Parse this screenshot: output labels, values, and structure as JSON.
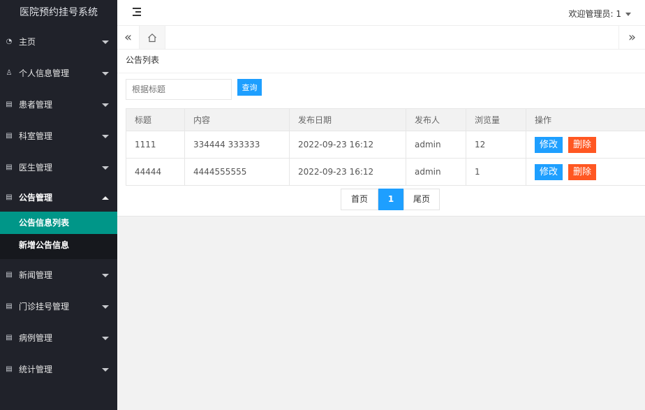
{
  "app_title": "医院预约挂号系统",
  "header": {
    "welcome": "欢迎管理员: 1"
  },
  "sidebar": {
    "items": [
      {
        "label": "主页",
        "icon": "dashboard-icon"
      },
      {
        "label": "个人信息管理",
        "icon": "user-icon"
      },
      {
        "label": "患者管理",
        "icon": "list-icon"
      },
      {
        "label": "科室管理",
        "icon": "list-icon"
      },
      {
        "label": "医生管理",
        "icon": "list-icon"
      },
      {
        "label": "公告管理",
        "icon": "list-icon",
        "expanded": true
      },
      {
        "label": "新闻管理",
        "icon": "list-icon"
      },
      {
        "label": "门诊挂号管理",
        "icon": "list-icon"
      },
      {
        "label": "病例管理",
        "icon": "list-icon"
      },
      {
        "label": "统计管理",
        "icon": "list-icon"
      }
    ],
    "submenu": [
      {
        "label": "公告信息列表",
        "active": true
      },
      {
        "label": "新增公告信息",
        "active": false
      }
    ]
  },
  "tabs": {
    "home_icon": "home-icon"
  },
  "page": {
    "card_title": "公告列表",
    "search_placeholder": "根据标题",
    "search_button": "查询"
  },
  "table": {
    "columns": [
      "标题",
      "内容",
      "发布日期",
      "发布人",
      "浏览量",
      "操作"
    ],
    "rows": [
      {
        "title": "1111",
        "content": "334444 333333",
        "date": "2022-09-23 16:12",
        "author": "admin",
        "views": "12"
      },
      {
        "title": "44444",
        "content": "4444555555",
        "date": "2022-09-23 16:12",
        "author": "admin",
        "views": "1"
      }
    ],
    "edit_label": "修改",
    "delete_label": "删除"
  },
  "pager": {
    "first": "首页",
    "current": "1",
    "last": "尾页"
  },
  "colors": {
    "sidebar_bg": "#20222a",
    "active_green": "#009688",
    "primary_blue": "#1e9fff",
    "danger_orange": "#ff5722"
  }
}
